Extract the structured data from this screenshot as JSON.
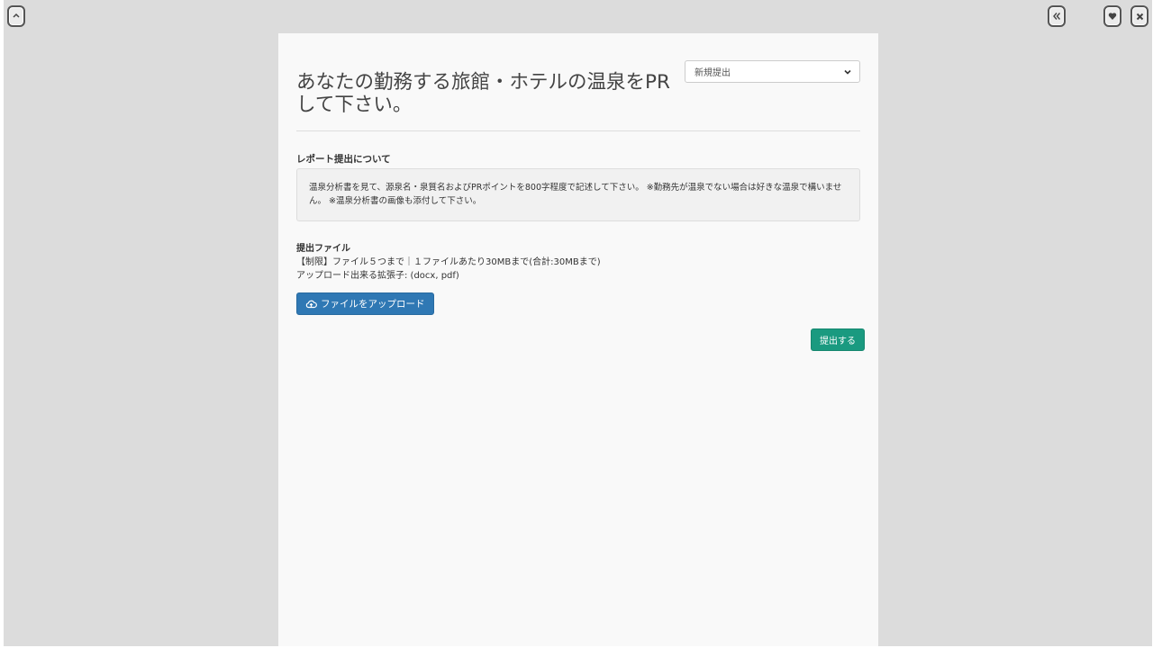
{
  "window_controls": {
    "up_icon": "chevron-up-icon",
    "back_icon": "double-chevron-left-icon",
    "heart_icon": "heart-icon",
    "close_icon": "close-icon"
  },
  "header": {
    "title": "あなたの勤務する旅館・ホテルの温泉をPRして下さい。",
    "submission_select": {
      "selected": "新規提出"
    }
  },
  "about": {
    "heading": "レポート提出について",
    "body": "温泉分析書を見て、源泉名・泉質名およびPRポイントを800字程度で記述して下さい。 ※勤務先が温泉でない場合は好きな温泉で構いません。 ※温泉分析書の画像も添付して下さい。"
  },
  "files": {
    "label": "提出ファイル",
    "limit": "【制限】ファイル５つまで｜１ファイルあたり30MBまで(合計:30MBまで)",
    "extensions": "アップロード出来る拡張子: (docx, pdf)",
    "upload_button": "ファイルをアップロード",
    "upload_icon": "cloud-upload-icon"
  },
  "actions": {
    "submit_button": "提出する"
  },
  "colors": {
    "upload_button": "#2f78b4",
    "submit_button": "#1a9a80",
    "background": "#dcdcdc",
    "panel": "#f9f9f9"
  }
}
